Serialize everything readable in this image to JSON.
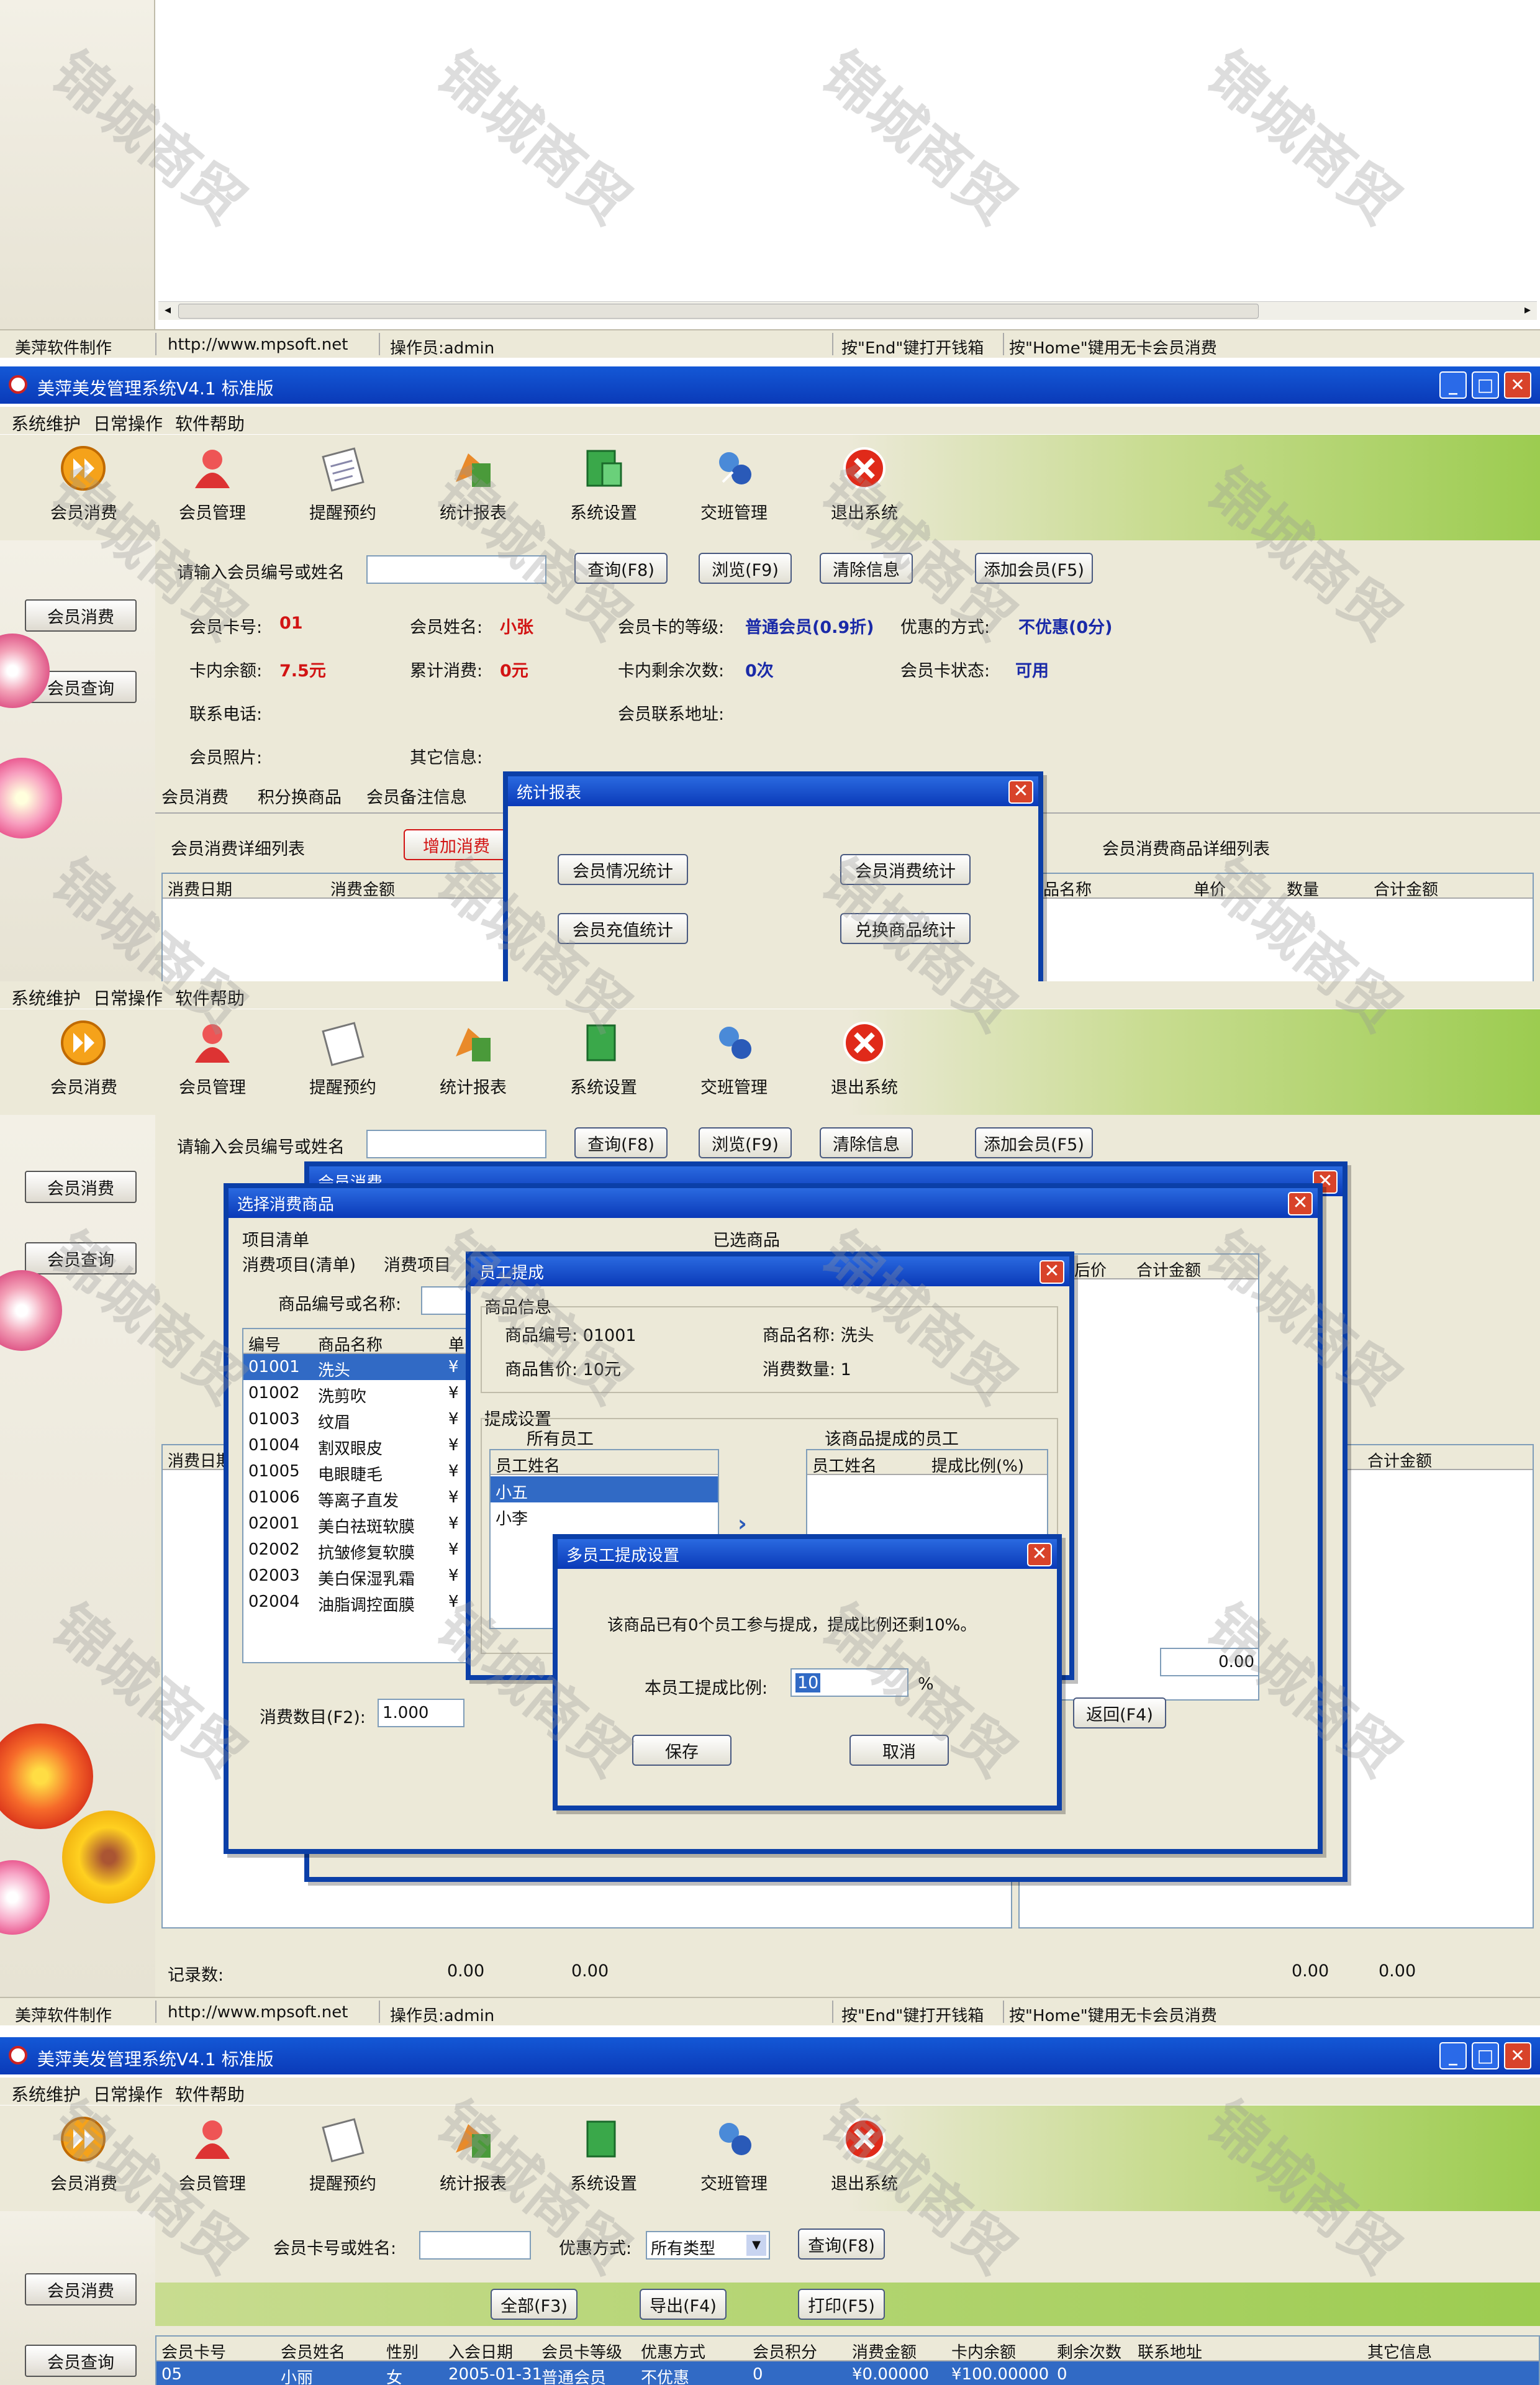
{
  "app": {
    "title": "美萍美发管理系统V4.1 标准版",
    "menu": [
      "系统维护",
      "日常操作",
      "软件帮助"
    ],
    "toolbar": [
      {
        "label": "会员消费",
        "icon": "forward-icon"
      },
      {
        "label": "会员管理",
        "icon": "member-icon"
      },
      {
        "label": "提醒预约",
        "icon": "notepad-icon"
      },
      {
        "label": "统计报表",
        "icon": "chart-icon"
      },
      {
        "label": "系统设置",
        "icon": "settings-icon"
      },
      {
        "label": "交班管理",
        "icon": "shift-icon"
      },
      {
        "label": "退出系统",
        "icon": "exit-icon"
      }
    ],
    "sidebar": {
      "consume": "会员消费",
      "query": "会员查询"
    }
  },
  "statusbar": {
    "maker": "美萍软件制作",
    "url": "http://www.mpsoft.net",
    "operator": "操作员:admin",
    "hint1": "按\"End\"键打开钱箱",
    "hint2": "按\"Home\"键用无卡会员消费"
  },
  "search": {
    "label": "请输入会员编号或姓名",
    "query_btn": "查询(F8)",
    "browse_btn": "浏览(F9)",
    "clear_btn": "清除信息",
    "add_btn": "添加会员(F5)"
  },
  "member": {
    "card_no_label": "会员卡号:",
    "card_no": "01",
    "name_label": "会员姓名:",
    "name": "小张",
    "level_label": "会员卡的等级:",
    "level": "普通会员(0.9折)",
    "discount_label": "优惠的方式:",
    "discount": "不优惠(0分)",
    "balance_label": "卡内余额:",
    "balance": "7.5元",
    "total_label": "累计消费:",
    "total": "0元",
    "times_label": "卡内剩余次数:",
    "times": "0次",
    "status_label": "会员卡状态:",
    "status": "可用",
    "phone_label": "联系电话:",
    "addr_label": "会员联系地址:",
    "photo_label": "会员照片:",
    "other_label": "其它信息:"
  },
  "tabs": [
    "会员消费",
    "积分换商品",
    "会员备注信息"
  ],
  "detail": {
    "list_label": "会员消费详细列表",
    "add_consume": "增加消费",
    "cols": [
      "消费日期",
      "消费金额"
    ],
    "goods_label": "会员消费商品详细列表",
    "goods_cols": [
      "品名称",
      "单价",
      "数量",
      "合计金额"
    ]
  },
  "stats_dialog": {
    "title": "统计报表",
    "buttons": [
      "会员情况统计",
      "会员消费统计",
      "会员充值统计",
      "兑换商品统计"
    ]
  },
  "consume_dialog": {
    "title_back": "会员消费",
    "title": "选择消费商品",
    "group_label": "项目清单",
    "selected_label": "已选商品",
    "tabs": [
      "消费项目(清单)",
      "消费项目"
    ],
    "code_label": "商品编号或名称:",
    "cols": [
      "编号",
      "商品名称",
      "单"
    ],
    "items": [
      {
        "code": "01001",
        "name": "洗头",
        "price": "¥"
      },
      {
        "code": "01002",
        "name": "洗剪吹",
        "price": "¥"
      },
      {
        "code": "01003",
        "name": "纹眉",
        "price": "¥"
      },
      {
        "code": "01004",
        "name": "割双眼皮",
        "price": "¥"
      },
      {
        "code": "01005",
        "name": "电眼睫毛",
        "price": "¥"
      },
      {
        "code": "01006",
        "name": "等离子直发",
        "price": "¥"
      },
      {
        "code": "02001",
        "name": "美白祛斑软膜",
        "price": "¥"
      },
      {
        "code": "02002",
        "name": "抗皱修复软膜",
        "price": "¥"
      },
      {
        "code": "02003",
        "name": "美白保湿乳霜",
        "price": "¥"
      },
      {
        "code": "02004",
        "name": "油脂调控面膜",
        "price": "¥"
      }
    ],
    "right_cols": [
      "折后价",
      "合计金额"
    ],
    "qty_label": "消费数目(F2):",
    "qty": "1.000",
    "total_value": "0.00",
    "return_btn": "返回(F4)"
  },
  "staff_dialog": {
    "title": "员工提成",
    "goods_group": "商品信息",
    "code_label": "商品编号: 01001",
    "name_label": "商品名称: 洗头",
    "price_label": "商品售价: 10元",
    "qty_label": "消费数量: 1",
    "set_group": "提成设置",
    "all_label": "所有员工",
    "this_label": "该商品提成的员工",
    "col_name": "员工姓名",
    "col_ratio": "提成比例(%)",
    "staff": [
      "小五",
      "小李"
    ]
  },
  "multi_dialog": {
    "title": "多员工提成设置",
    "message": "该商品已有0个员工参与提成，提成比例还剩10%。",
    "ratio_label": "本员工提成比例:",
    "ratio_value": "10",
    "unit": "%",
    "save_btn": "保存",
    "cancel_btn": "取消"
  },
  "records": {
    "label": "记录数:",
    "v1": "0.00",
    "v2": "0.00",
    "v3": "0.00",
    "v4": "0.00"
  },
  "query_panel": {
    "card_label": "会员卡号或姓名:",
    "discount_label": "优惠方式:",
    "discount_value": "所有类型",
    "query_btn": "查询(F8)",
    "all_btn": "全部(F3)",
    "export_btn": "导出(F4)",
    "print_btn": "打印(F5)",
    "cols": [
      "会员卡号",
      "会员姓名",
      "性别",
      "入会日期",
      "会员卡等级",
      "优惠方式",
      "会员积分",
      "消费金额",
      "卡内余额",
      "剩余次数",
      "联系地址",
      "其它信息"
    ],
    "row": [
      "05",
      "小丽",
      "女",
      "2005-01-31",
      "普通会员",
      "不优惠",
      "0",
      "¥0.00000",
      "¥100.00000",
      "0",
      "",
      ""
    ]
  },
  "watermark": "锦城商贸",
  "colors": {
    "title_blue": "#0a3ab8",
    "highlight": "#316ac5",
    "toolbar_green": "#9ccc50"
  }
}
